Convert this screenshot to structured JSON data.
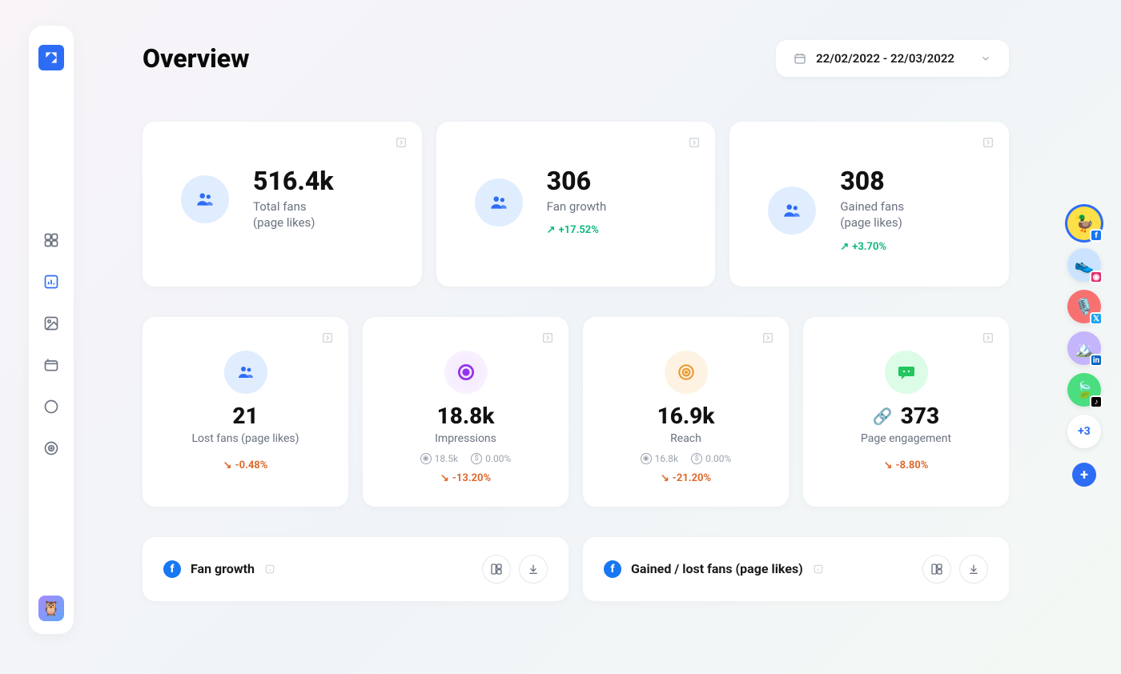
{
  "header": {
    "title": "Overview",
    "date_range": "22/02/2022 - 22/03/2022"
  },
  "sidebar": {
    "items": [
      "dashboard-icon",
      "analytics-icon",
      "media-icon",
      "calendar-icon",
      "comments-icon",
      "podcast-icon"
    ]
  },
  "stats_top": [
    {
      "value": "516.4k",
      "label": "Total fans\n(page likes)",
      "change": null
    },
    {
      "value": "306",
      "label": "Fan growth",
      "change": "+17.52%",
      "dir": "up"
    },
    {
      "value": "308",
      "label": "Gained fans\n(page likes)",
      "change": "+3.70%",
      "dir": "up"
    }
  ],
  "stats_bottom": [
    {
      "value": "21",
      "label": "Lost fans (page likes)",
      "change": "-0.48%",
      "dir": "down",
      "icon": "users",
      "color": "blue-light",
      "sub": null
    },
    {
      "value": "18.8k",
      "label": "Impressions",
      "change": "-13.20%",
      "dir": "down",
      "icon": "eye",
      "color": "purple",
      "sub": {
        "a": "18.5k",
        "b": "0.00%"
      }
    },
    {
      "value": "16.9k",
      "label": "Reach",
      "change": "-21.20%",
      "dir": "down",
      "icon": "target",
      "color": "orange",
      "sub": {
        "a": "16.8k",
        "b": "0.00%"
      }
    },
    {
      "value": "373",
      "label": "Page engagement",
      "change": "-8.80%",
      "dir": "down",
      "icon": "chat",
      "color": "green",
      "sub": null,
      "linkicon": true
    }
  ],
  "charts": [
    {
      "platform": "facebook",
      "title": "Fan growth"
    },
    {
      "platform": "facebook",
      "title": "Gained / lost fans (page likes)"
    }
  ],
  "accounts": [
    {
      "bg": "#fde047",
      "emoji": "🦆",
      "network": "facebook",
      "color": "#1877f2",
      "selected": true
    },
    {
      "bg": "#cbe3ff",
      "emoji": "👟",
      "network": "instagram",
      "color": "#e1306c",
      "selected": false
    },
    {
      "bg": "#f87171",
      "emoji": "🎙️",
      "network": "twitter",
      "color": "#1da1f2",
      "selected": false
    },
    {
      "bg": "#c4b5fd",
      "emoji": "🏔️",
      "network": "linkedin",
      "color": "#0a66c2",
      "selected": false
    },
    {
      "bg": "#4ade80",
      "emoji": "🍃",
      "network": "tiktok",
      "color": "#000000",
      "selected": false
    }
  ],
  "accounts_more": "+3"
}
